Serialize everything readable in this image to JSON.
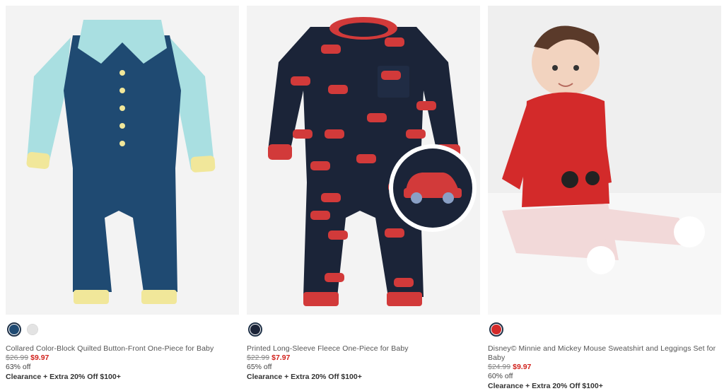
{
  "products": [
    {
      "name": "Collared Color-Block Quilted Button-Front One-Piece for Baby",
      "was_price": "$26.99",
      "sale_price": "$9.97",
      "discount": "63% off",
      "promo": "Clearance + Extra 20% Off $100+",
      "swatches": [
        {
          "color": "#1f4a72",
          "selected": true,
          "name": "navy-swatch-icon"
        },
        {
          "color": "#e3e3e3",
          "selected": false,
          "name": "light-gray-swatch-icon"
        }
      ],
      "image": {
        "bg": "#f3f3f3",
        "body": "#1f4a72",
        "sleeve": "#a9dfe1",
        "cuff": "#f1e79a"
      }
    },
    {
      "name": "Printed Long-Sleeve Fleece One-Piece for Baby",
      "was_price": "$22.99",
      "sale_price": "$7.97",
      "discount": "65% off",
      "promo": "Clearance + Extra 20% Off $100+",
      "swatches": [
        {
          "color": "#1b2438",
          "selected": true,
          "name": "navy-car-print-swatch-icon"
        }
      ],
      "image": {
        "bg": "#f3f3f3",
        "body": "#1b2438",
        "trim": "#d23a3a",
        "print": "#d23a3a"
      }
    },
    {
      "name": "Disney© Minnie and Mickey Mouse Sweatshirt and Leggings Set for Baby",
      "was_price": "$24.99",
      "sale_price": "$9.97",
      "discount": "60% off",
      "promo": "Clearance + Extra 20% Off $100+",
      "swatches": [
        {
          "color": "#d42a2a",
          "selected": true,
          "name": "red-swatch-icon"
        }
      ],
      "image": {
        "bg": "#efefef",
        "top": "#d32a2a",
        "legs": "#f2d9d9"
      }
    }
  ]
}
